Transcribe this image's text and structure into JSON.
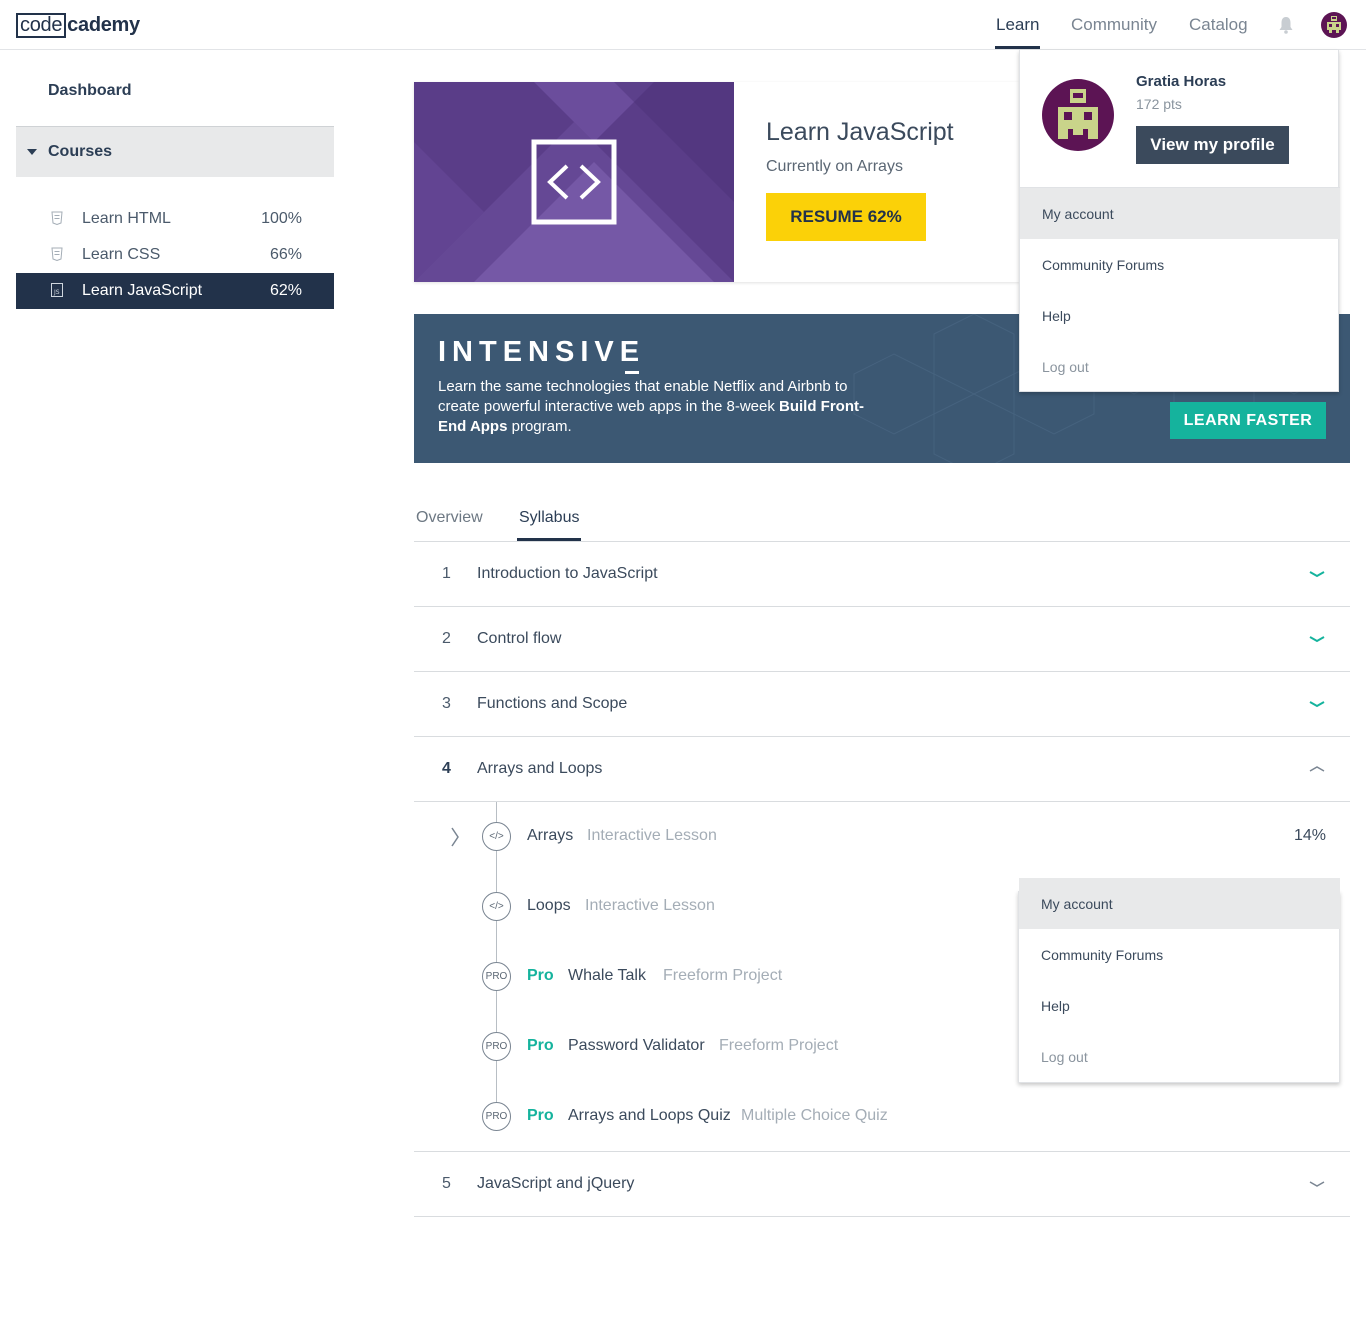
{
  "nav": {
    "logo_boxed": "code",
    "logo_rest": "cademy",
    "links": [
      "Learn",
      "Community",
      "Catalog"
    ],
    "active": "Learn",
    "bell_icon": "bell-icon",
    "avatar_icon": "avatar-icon"
  },
  "sidebar": {
    "dashboard": "Dashboard",
    "courses_label": "Courses",
    "courses": [
      {
        "name": "Learn HTML",
        "percent": "100%",
        "icon": "html-file-icon"
      },
      {
        "name": "Learn CSS",
        "percent": "66%",
        "icon": "css-file-icon"
      },
      {
        "name": "Learn JavaScript",
        "percent": "62%",
        "icon": "js-file-icon"
      }
    ]
  },
  "hero": {
    "title": "Learn JavaScript",
    "subtitle": "Currently on Arrays",
    "resume_label": "RESUME 62%",
    "code_icon": "code-brackets-icon"
  },
  "banner": {
    "word": "INTENSIVE",
    "text_a": "Learn the same technologies that enable Netflix and Airbnb to create powerful interactive web apps in the 8-week ",
    "text_bold": "Build Front-End Apps",
    "text_b": " program.",
    "button": "LEARN FASTER"
  },
  "tabs": [
    "Overview",
    "Syllabus"
  ],
  "active_tab": "Syllabus",
  "syllabus": {
    "sections": [
      {
        "num": "1",
        "title": "Introduction to JavaScript"
      },
      {
        "num": "2",
        "title": "Control flow"
      },
      {
        "num": "3",
        "title": "Functions and Scope"
      },
      {
        "num": "4",
        "title": "Arrays and Loops"
      },
      {
        "num": "5",
        "title": "JavaScript and jQuery"
      }
    ],
    "lessons": [
      {
        "name": "Arrays",
        "type": "Interactive Lesson",
        "percent": "14%",
        "icon_text": "</>"
      },
      {
        "name": "Loops",
        "type": "Interactive Lesson",
        "icon_text": "</>"
      },
      {
        "pro": "Pro",
        "name": "Whale Talk",
        "type": "Freeform Project",
        "icon_text": "PRO"
      },
      {
        "pro": "Pro",
        "name": "Password Validator",
        "type": "Freeform Project",
        "icon_text": "PRO"
      },
      {
        "pro": "Pro",
        "name": "Arrays and Loops Quiz",
        "type": "Multiple Choice Quiz",
        "icon_text": "PRO"
      }
    ]
  },
  "profile_menu": {
    "name": "Gratia Horas",
    "points": "172 pts",
    "view_profile": "View my profile",
    "items": [
      "My account",
      "Community Forums",
      "Help",
      "Log out"
    ]
  },
  "colors": {
    "navy": "#22324a",
    "teal": "#15b39d",
    "yellow": "#fbd108",
    "purple": "#5d3e8c",
    "banner": "#3c5873"
  }
}
